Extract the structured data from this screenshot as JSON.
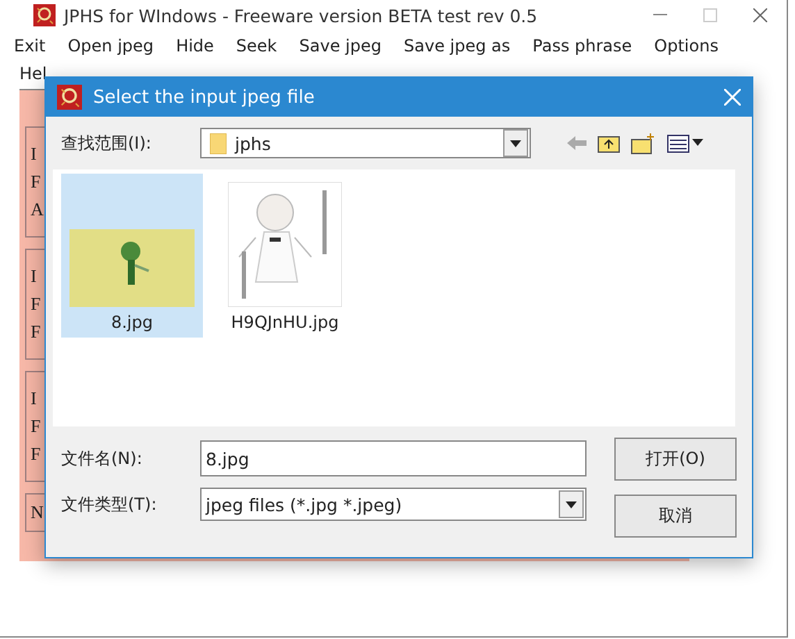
{
  "window": {
    "title": "JPHS for WIndows - Freeware version BETA test rev 0.5"
  },
  "menu": [
    "Exit",
    "Open jpeg",
    "Hide",
    "Seek",
    "Save jpeg",
    "Save jpeg as",
    "Pass phrase",
    "Options"
  ],
  "menu_row_2": [
    "Hel"
  ],
  "panels": [
    {
      "letters": [
        "I",
        "F",
        "A"
      ]
    },
    {
      "letters": [
        "I",
        "F",
        "F"
      ]
    },
    {
      "letters": [
        "I",
        "F",
        "F"
      ]
    },
    {
      "letters": [
        "N"
      ]
    }
  ],
  "dialog": {
    "title": "Select the input jpeg file",
    "look_in": {
      "label": "查找范围(I):",
      "value": "jphs"
    },
    "files": [
      {
        "name": "8.jpg",
        "selected": true,
        "kind": "picture"
      },
      {
        "name": "H9QJnHU.jpg",
        "selected": false,
        "kind": "picture"
      }
    ],
    "file_name": {
      "label": "文件名(N):",
      "value": "8.jpg"
    },
    "file_type": {
      "label": "文件类型(T):",
      "value": "jpeg files (*.jpg *.jpeg)"
    },
    "buttons": [
      "打开(O)",
      "取消"
    ]
  }
}
